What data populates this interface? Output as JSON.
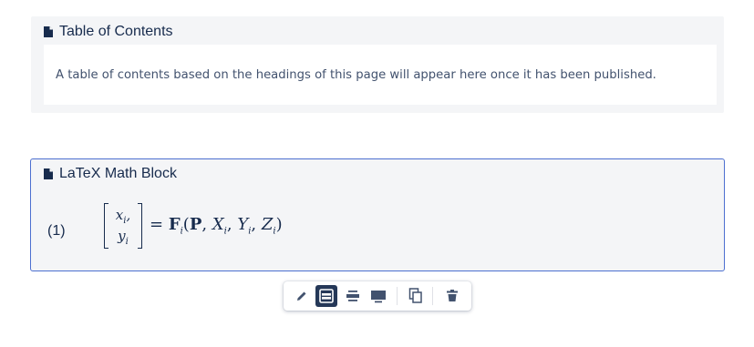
{
  "toc_macro": {
    "title": "Table of Contents",
    "placeholder_text": "A table of contents based on the headings of this page will appear here once it has been published."
  },
  "math_macro": {
    "title": "LaTeX Math Block",
    "equation_number": "(1)",
    "matrix_rows": [
      "x",
      "y"
    ],
    "matrix_row_punct": [
      ",",
      ""
    ],
    "subscript": "i"
  },
  "toolbar": {
    "buttons": [
      {
        "icon": "pencil-icon",
        "state": "default"
      },
      {
        "icon": "layout-full-width-icon",
        "state": "active"
      },
      {
        "icon": "layout-center-icon",
        "state": "default"
      },
      {
        "icon": "layout-wide-icon",
        "state": "default"
      },
      {
        "icon": "copy-icon",
        "state": "default"
      },
      {
        "icon": "trash-icon",
        "state": "default"
      }
    ]
  },
  "colors": {
    "active_border": "#4c6fd0",
    "panel_bg": "#f4f5f7",
    "active_button_bg": "#253858",
    "icon": "#42526e"
  }
}
